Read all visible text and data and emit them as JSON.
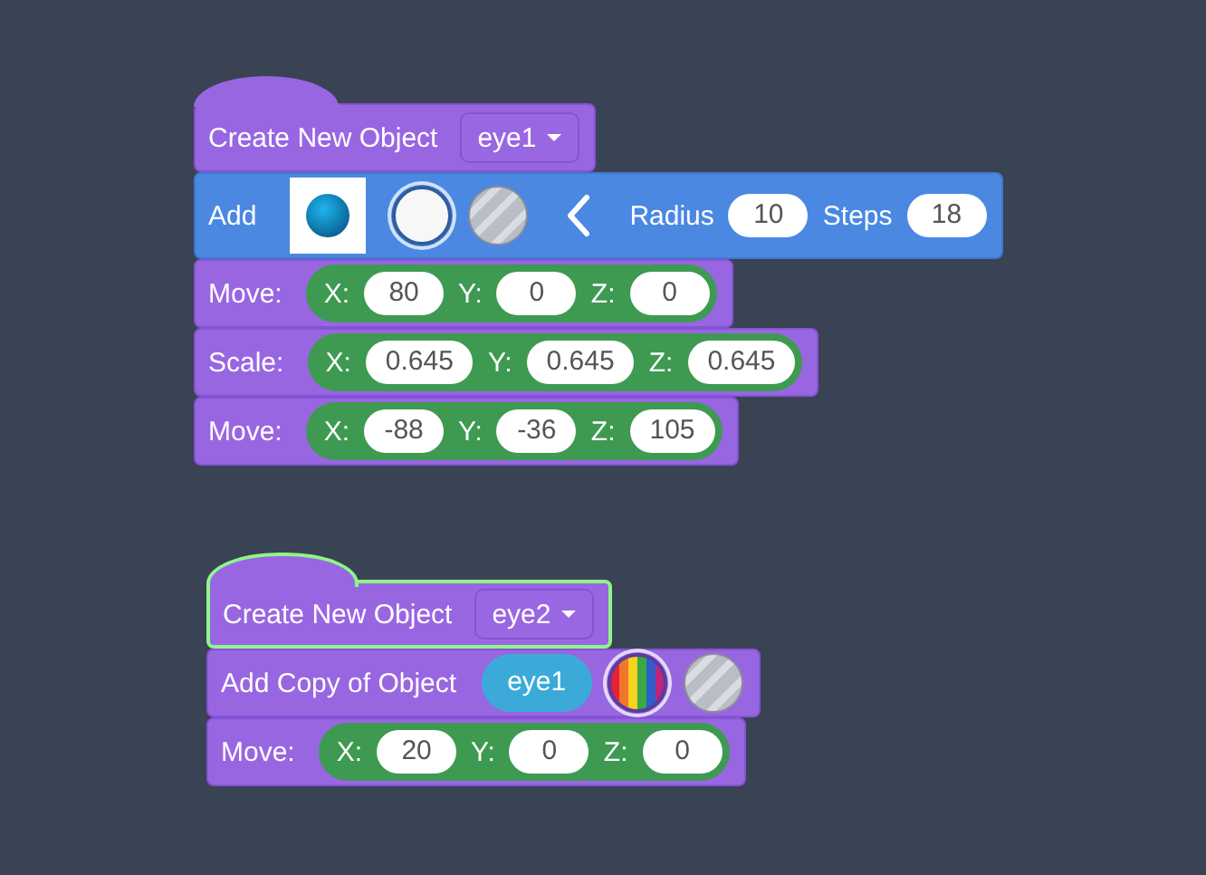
{
  "stacks": [
    {
      "selected": false,
      "blocks": [
        {
          "kind": "create",
          "label": "Create New Object",
          "value": "eye1"
        },
        {
          "kind": "add",
          "label": "Add",
          "swatches": [
            {
              "kind": "white",
              "selected": true
            },
            {
              "kind": "metal",
              "selected": false
            }
          ],
          "fields": [
            {
              "label": "Radius",
              "value": "10"
            },
            {
              "label": "Steps",
              "value": "18"
            }
          ]
        },
        {
          "kind": "xyz",
          "label": "Move:",
          "fields": [
            {
              "label": "X:",
              "value": "80"
            },
            {
              "label": "Y:",
              "value": "0"
            },
            {
              "label": "Z:",
              "value": "0"
            }
          ]
        },
        {
          "kind": "xyz",
          "label": "Scale:",
          "fields": [
            {
              "label": "X:",
              "value": "0.645"
            },
            {
              "label": "Y:",
              "value": "0.645"
            },
            {
              "label": "Z:",
              "value": "0.645"
            }
          ]
        },
        {
          "kind": "xyz",
          "label": "Move:",
          "fields": [
            {
              "label": "X:",
              "value": "-88"
            },
            {
              "label": "Y:",
              "value": "-36"
            },
            {
              "label": "Z:",
              "value": "105"
            }
          ]
        }
      ]
    },
    {
      "selected": true,
      "blocks": [
        {
          "kind": "create",
          "label": "Create New Object",
          "value": "eye2"
        },
        {
          "kind": "copy",
          "label": "Add Copy of Object",
          "value": "eye1",
          "swatches": [
            {
              "kind": "rainbow",
              "selected": true
            },
            {
              "kind": "metal",
              "selected": false
            }
          ]
        },
        {
          "kind": "xyz",
          "label": "Move:",
          "fields": [
            {
              "label": "X:",
              "value": "20"
            },
            {
              "label": "Y:",
              "value": "0"
            },
            {
              "label": "Z:",
              "value": "0"
            }
          ]
        }
      ]
    }
  ]
}
